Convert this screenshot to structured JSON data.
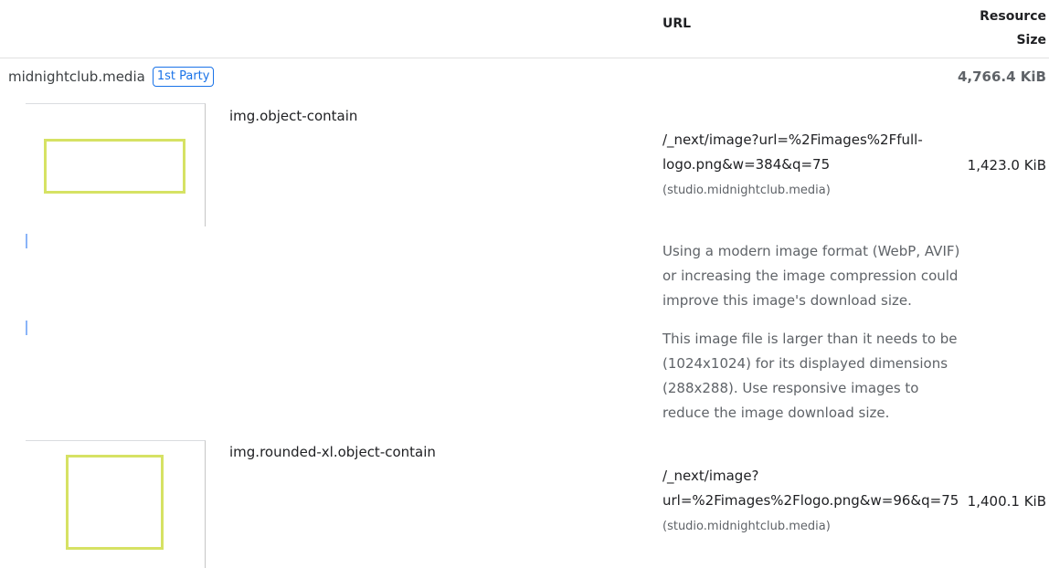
{
  "table": {
    "columns": {
      "url_label": "URL",
      "resource_label_line1": "Resource",
      "resource_label_line2": "Size"
    },
    "group": {
      "origin": "midnightclub.media",
      "badge": "1st Party",
      "total_size": "4,766.4 KiB"
    },
    "rows": [
      {
        "selector": "img.object-contain",
        "url_part1": "/_next/image?url=%2Fimages%2Ffull-",
        "url_part2": "logo.png&w=384&q=75",
        "domain": "(studio.midnightclub.media)",
        "size": "1,423.0 KiB",
        "notes": [
          "Using a modern image format (WebP, AVIF) or increasing the image compression could improve this image's download size.",
          "This image file is larger than it needs to be (1024x1024) for its displayed dimensions (288x288). Use responsive images to reduce the image download size."
        ]
      },
      {
        "selector": "img.rounded-xl.object-contain",
        "url_part1": "/_next/image?",
        "url_part2": "url=%2Fimages%2Flogo.png&w=96&q=75",
        "domain": "(studio.midnightclub.media)",
        "size": "1,400.1 KiB"
      }
    ]
  }
}
